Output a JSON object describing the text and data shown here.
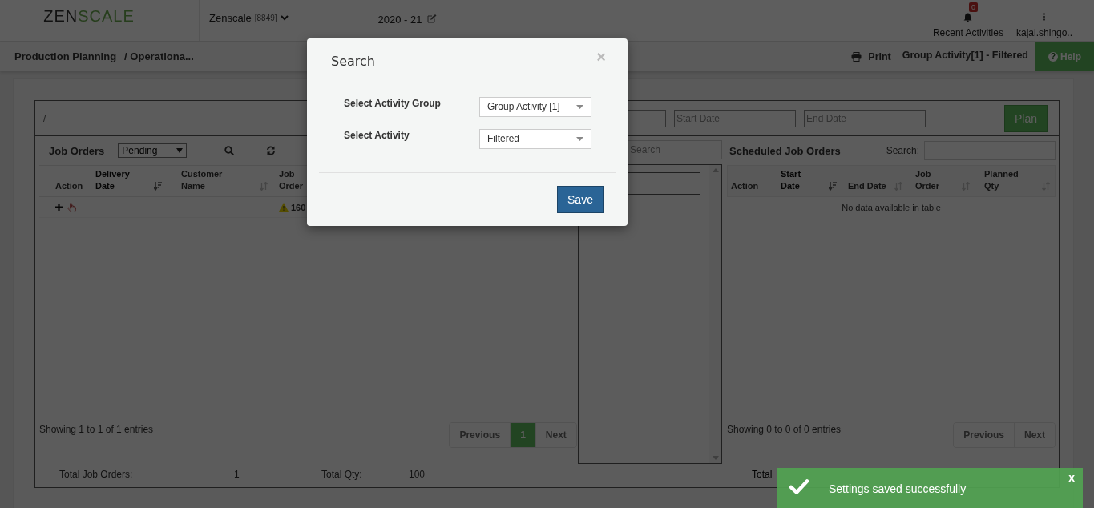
{
  "header": {
    "logo_dark": "ZEN",
    "logo_green": "SCALE",
    "company": "Zenscale",
    "company_code": "[8849]",
    "year": "2020 - 21",
    "notification_badge": "0",
    "notification_label": "Recent Activities",
    "user": "kajal.shingo.."
  },
  "breadcrumb": [
    "Production Planning",
    "/ Operationa..."
  ],
  "toolbar": {
    "print": "Print",
    "filter_summary": "Group Activity[1] - Filtered",
    "help_icon": "?",
    "help": "Help"
  },
  "panel": {
    "path": "/",
    "date_fields": [
      {
        "placeholder": "Start Date"
      },
      {
        "placeholder": "End Date"
      }
    ],
    "plan_button": "Plan"
  },
  "job_orders": {
    "title": "Job Orders",
    "status": "Pending",
    "columns": [
      {
        "label": "Action",
        "sortable": false,
        "sorted": false
      },
      {
        "label": "Delivery Date",
        "sortable": true,
        "sorted": true
      },
      {
        "label": "Customer Name",
        "sortable": true,
        "sorted": false
      },
      {
        "label": "Job Order"
      }
    ],
    "rows": [
      {
        "job_order": "160",
        "warning": true
      }
    ],
    "info": "Showing 1 to 1 of 1 entries",
    "pages": [
      {
        "label": "Previous",
        "selected": false
      },
      {
        "label": "1",
        "selected": true
      },
      {
        "label": "Next",
        "selected": false
      }
    ],
    "totals": [
      {
        "label": "Total Job Orders:",
        "value": "1"
      },
      {
        "label": "Total Qty:",
        "value": "100"
      }
    ]
  },
  "middle": {
    "search_placeholder": "Search"
  },
  "scheduled": {
    "title": "Scheduled Job Orders",
    "search_label": "Search:",
    "columns": [
      {
        "label": "Action",
        "sortable": false,
        "sorted": false
      },
      {
        "label": "Start Date",
        "sortable": true,
        "sorted": true
      },
      {
        "label": "End Date",
        "sortable": true,
        "sorted": false
      },
      {
        "label": "Job Order",
        "sortable": true,
        "sorted": false
      },
      {
        "label": "Planned Qty",
        "sortable": true,
        "sorted": false
      }
    ],
    "empty": "No data available in table",
    "info": "Showing 0 to 0 of 0 entries",
    "pages": [
      {
        "label": "Previous",
        "selected": false
      },
      {
        "label": "Next",
        "selected": false
      }
    ],
    "totals": [
      "Total"
    ]
  },
  "modal": {
    "title": "Search",
    "close": "×",
    "fields": [
      {
        "label": "Select Activity Group",
        "value": "Group Activity [1]"
      },
      {
        "label": "Select Activity",
        "value": "Filtered"
      }
    ],
    "save": "Save"
  },
  "toast": {
    "message": "Settings saved successfully",
    "close": "x"
  }
}
